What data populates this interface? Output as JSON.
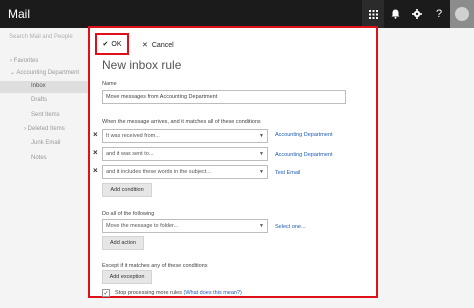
{
  "app": {
    "title": "Mail"
  },
  "top_icons": [
    "apps-grid-icon",
    "bell-icon",
    "gear-icon",
    "help-icon"
  ],
  "sidebar": {
    "search_placeholder": "Search Mail and People",
    "favorites": "Favorites",
    "account": "Accounting Department",
    "inbox": "Inbox",
    "drafts": "Drafts",
    "sent": "Sent Items",
    "deleted": "Deleted Items",
    "junk": "Junk Email",
    "notes": "Notes"
  },
  "dialog": {
    "ok": "OK",
    "cancel": "Cancel",
    "title": "New inbox rule",
    "name_label": "Name",
    "name_value": "Move messages from Accounting Department",
    "conditions_label": "When the message arrives, and it matches all of these conditions",
    "conditions": [
      {
        "select": "It was received from...",
        "link": "Accounting Department"
      },
      {
        "select": "and it was sent to...",
        "link": "Accounting Department"
      },
      {
        "select": "and it includes these words in the subject...",
        "link": "Test Email"
      }
    ],
    "add_condition": "Add condition",
    "actions_label": "Do all of the following",
    "action_select": "Move the message to folder...",
    "action_link": "Select one...",
    "add_action": "Add action",
    "exceptions_label": "Except if it matches any of these conditions",
    "add_exception": "Add exception",
    "stop_label": "Stop processing more rules",
    "stop_link": "(What does this mean?)",
    "stop_checked": true
  },
  "colors": {
    "highlight": "#e0101a",
    "link": "#1e5db8",
    "topbar": "#1b1b1b"
  }
}
